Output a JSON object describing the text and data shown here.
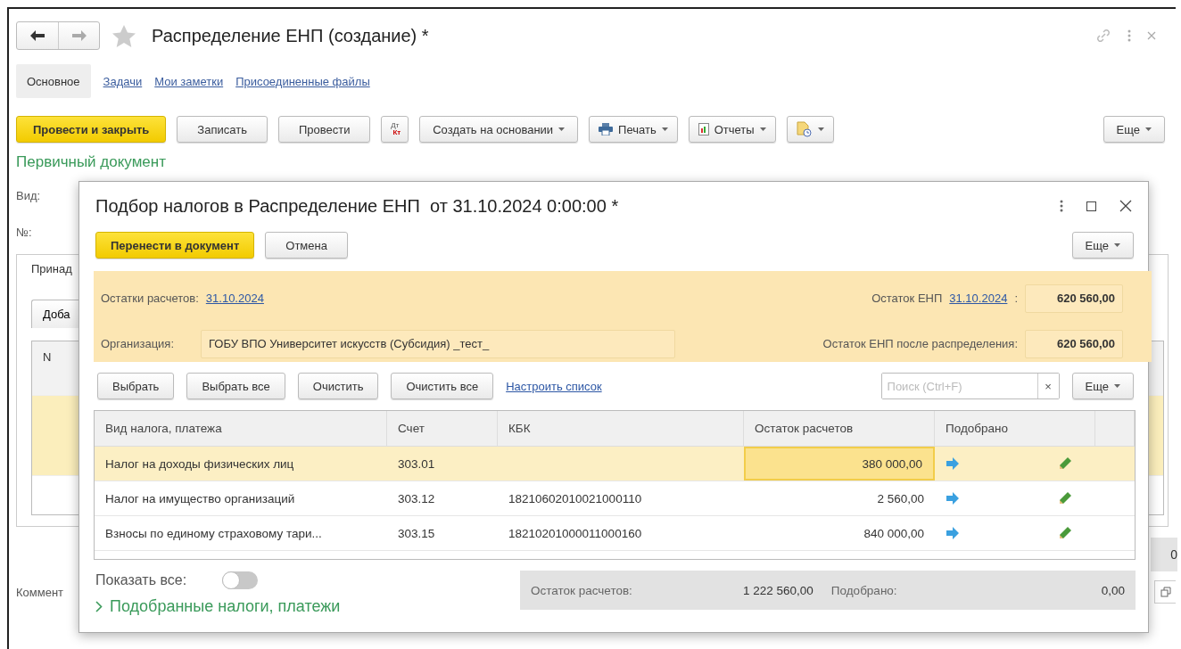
{
  "window": {
    "title": "Распределение ЕНП (создание) *"
  },
  "tabs": [
    {
      "label": "Основное",
      "selected": true
    },
    {
      "label": "Задачи",
      "selected": false
    },
    {
      "label": "Мои заметки",
      "selected": false
    },
    {
      "label": "Присоединенные файлы",
      "selected": false
    }
  ],
  "toolbar": [
    {
      "kind": "primary",
      "label": "Провести и закрыть"
    },
    {
      "kind": "plain",
      "label": "Записать"
    },
    {
      "kind": "plain",
      "label": "Провести"
    },
    {
      "kind": "dtkt",
      "label": "Дт",
      "sub": "Кт"
    },
    {
      "kind": "menu",
      "label": "Создать на основании"
    },
    {
      "kind": "print",
      "label": "Печать"
    },
    {
      "kind": "report",
      "label": "Отчеты"
    },
    {
      "kind": "doc"
    },
    {
      "kind": "more",
      "label": "Еще"
    }
  ],
  "section_title": "Первичный документ",
  "fields": [
    {
      "label": "Вид:"
    },
    {
      "label": "№:"
    }
  ],
  "panel": {
    "tab": "Принад",
    "add_button": "Доба",
    "column": "N",
    "rows": [
      {
        "selected": true
      },
      {
        "selected": false
      }
    ],
    "total": "0"
  },
  "comment_label": "Коммент",
  "dialog": {
    "title": "Подбор налогов в Распределение ЕНП  от 31.10.2024 0:00:00 *",
    "buttons": [
      {
        "kind": "primary",
        "label": "Перенести в документ"
      },
      {
        "kind": "plain",
        "label": "Отмена"
      },
      {
        "kind": "more",
        "label": "Еще"
      }
    ],
    "balances_label": "Остатки расчетов:",
    "balances_date": "31.10.2024",
    "org_label": "Организация:",
    "org_value": "ГОБУ ВПО Университет искусств (Субсидия) _тест_",
    "enp_label": "Остаток ЕНП",
    "enp_date": "31.10.2024",
    "enp_colon": ":",
    "enp_value": "620 560,00",
    "after_label": "Остаток ЕНП после распределения:",
    "after_value": "620 560,00",
    "list_buttons": [
      "Выбрать",
      "Выбрать все",
      "Очистить",
      "Очистить все"
    ],
    "setup_link": "Настроить список",
    "search": {
      "placeholder": "Поиск (Ctrl+F)",
      "clear": "×"
    },
    "more": "Еще",
    "table": {
      "columns": [
        "Вид налога, платежа",
        "Счет",
        "КБК",
        "Остаток расчетов",
        "Подобрано"
      ],
      "rows": [
        {
          "name": "Налог на доходы физических лиц",
          "account": "303.01",
          "kbk": "",
          "balance": "380 000,00",
          "selected": true
        },
        {
          "name": "Налог на имущество организаций",
          "account": "303.12",
          "kbk": "18210602010021000110",
          "balance": "2 560,00",
          "selected": false
        },
        {
          "name": "Взносы по единому страховому тари...",
          "account": "303.15",
          "kbk": "18210201000011000160",
          "balance": "840 000,00",
          "selected": false
        }
      ]
    },
    "show_all": {
      "label": "Показать все:",
      "on": false
    },
    "picked_link": "Подобранные налоги, платежи",
    "totals": [
      {
        "label": "Остаток расчетов:",
        "value": "1 222 560,00"
      },
      {
        "label": "Подобрано:",
        "value": "0,00"
      }
    ]
  }
}
